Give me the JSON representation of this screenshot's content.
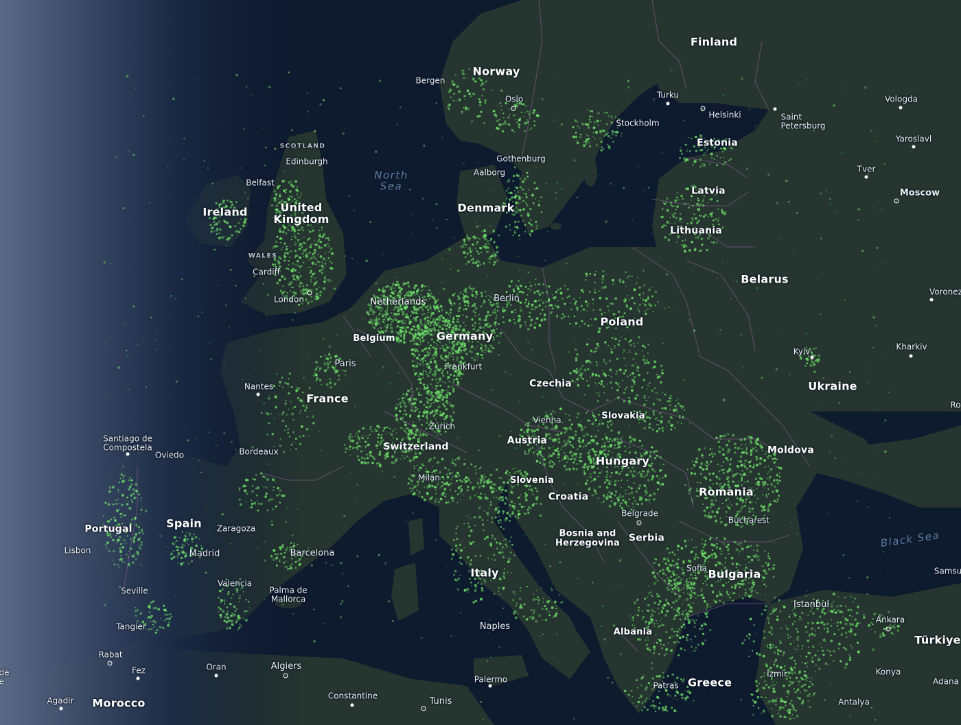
{
  "map": {
    "colors": {
      "water": "#0e1a2e",
      "land": "#26352f",
      "border": "#7a5a86",
      "activity": "#6fe06a"
    },
    "countries": [
      {
        "key": "norway",
        "name": "Norway"
      },
      {
        "key": "finland",
        "name": "Finland"
      },
      {
        "key": "estonia",
        "name": "Estonia"
      },
      {
        "key": "latvia",
        "name": "Latvia"
      },
      {
        "key": "lithuania",
        "name": "Lithuania"
      },
      {
        "key": "belarus",
        "name": "Belarus"
      },
      {
        "key": "denmark",
        "name": "Denmark"
      },
      {
        "key": "ireland",
        "name": "Ireland"
      },
      {
        "key": "uk",
        "name": "United\nKingdom"
      },
      {
        "key": "netherlands",
        "name": "Netherlands"
      },
      {
        "key": "belgium",
        "name": "Belgium"
      },
      {
        "key": "germany",
        "name": "Germany"
      },
      {
        "key": "poland",
        "name": "Poland"
      },
      {
        "key": "czechia",
        "name": "Czechia"
      },
      {
        "key": "slovakia",
        "name": "Slovakia"
      },
      {
        "key": "ukraine",
        "name": "Ukraine"
      },
      {
        "key": "france",
        "name": "France"
      },
      {
        "key": "austria",
        "name": "Austria"
      },
      {
        "key": "switzerland",
        "name": "Switzerland"
      },
      {
        "key": "hungary",
        "name": "Hungary"
      },
      {
        "key": "moldova",
        "name": "Moldova"
      },
      {
        "key": "romania",
        "name": "Romania"
      },
      {
        "key": "slovenia",
        "name": "Slovenia"
      },
      {
        "key": "croatia",
        "name": "Croatia"
      },
      {
        "key": "bosnia",
        "name": "Bosnia and\nHerzegovina"
      },
      {
        "key": "serbia",
        "name": "Serbia"
      },
      {
        "key": "bulgaria",
        "name": "Bulgaria"
      },
      {
        "key": "spain",
        "name": "Spain"
      },
      {
        "key": "portugal",
        "name": "Portugal"
      },
      {
        "key": "italy",
        "name": "Italy"
      },
      {
        "key": "albania",
        "name": "Albania"
      },
      {
        "key": "greece",
        "name": "Greece"
      },
      {
        "key": "turkiye",
        "name": "Türkiye"
      },
      {
        "key": "morocco",
        "name": "Morocco"
      }
    ],
    "cities": [
      {
        "key": "bergen",
        "name": "Bergen"
      },
      {
        "key": "oslo",
        "name": "Oslo"
      },
      {
        "key": "stockholm",
        "name": "Stockholm"
      },
      {
        "key": "turku",
        "name": "Turku"
      },
      {
        "key": "helsinki",
        "name": "Helsinki"
      },
      {
        "key": "saint_petersburg",
        "name": "Saint\nPetersburg"
      },
      {
        "key": "vologda",
        "name": "Vologda"
      },
      {
        "key": "yaroslavl",
        "name": "Yaroslavl"
      },
      {
        "key": "tver",
        "name": "Tver"
      },
      {
        "key": "moscow",
        "name": "Moscow"
      },
      {
        "key": "voronezh",
        "name": "Voronez"
      },
      {
        "key": "kharkiv",
        "name": "Kharkiv"
      },
      {
        "key": "kyiv",
        "name": "Kyiv"
      },
      {
        "key": "ro_cut",
        "name": "Ro"
      },
      {
        "key": "gothenburg",
        "name": "Gothenburg"
      },
      {
        "key": "aalborg",
        "name": "Aalborg"
      },
      {
        "key": "edinburgh",
        "name": "Edinburgh"
      },
      {
        "key": "belfast",
        "name": "Belfast"
      },
      {
        "key": "cardiff",
        "name": "Cardiff"
      },
      {
        "key": "london",
        "name": "London"
      },
      {
        "key": "berlin",
        "name": "Berlin"
      },
      {
        "key": "paris",
        "name": "Paris"
      },
      {
        "key": "frankfurt",
        "name": "Frankfurt"
      },
      {
        "key": "nantes",
        "name": "Nantes"
      },
      {
        "key": "vienna",
        "name": "Vienna"
      },
      {
        "key": "zurich",
        "name": "Zürich"
      },
      {
        "key": "bordeaux",
        "name": "Bordeaux"
      },
      {
        "key": "milan",
        "name": "Milan"
      },
      {
        "key": "santiago",
        "name": "Santiago de\nCompostela"
      },
      {
        "key": "oviedo",
        "name": "Oviedo"
      },
      {
        "key": "zaragoza",
        "name": "Zaragoza"
      },
      {
        "key": "madrid",
        "name": "Madrid"
      },
      {
        "key": "barcelona",
        "name": "Barcelona"
      },
      {
        "key": "lisbon",
        "name": "Lisbon"
      },
      {
        "key": "valencia",
        "name": "Valencia"
      },
      {
        "key": "palma",
        "name": "Palma de\nMallorca"
      },
      {
        "key": "seville",
        "name": "Seville"
      },
      {
        "key": "tangier",
        "name": "Tangier"
      },
      {
        "key": "rabat",
        "name": "Rabat"
      },
      {
        "key": "fez",
        "name": "Fez"
      },
      {
        "key": "oran",
        "name": "Oran"
      },
      {
        "key": "algiers",
        "name": "Algiers"
      },
      {
        "key": "agadir",
        "name": "Agadir"
      },
      {
        "key": "constantine",
        "name": "Constantine"
      },
      {
        "key": "tunis",
        "name": "Tunis"
      },
      {
        "key": "palermo",
        "name": "Palermo"
      },
      {
        "key": "naples",
        "name": "Naples"
      },
      {
        "key": "belgrade",
        "name": "Belgrade"
      },
      {
        "key": "bucharest",
        "name": "Bucharest"
      },
      {
        "key": "sofia",
        "name": "Sofia"
      },
      {
        "key": "istanbul",
        "name": "Istanbul"
      },
      {
        "key": "ankara",
        "name": "Ankara"
      },
      {
        "key": "samsun",
        "name": "Samsu"
      },
      {
        "key": "izmir",
        "name": "İzmir"
      },
      {
        "key": "konya",
        "name": "Konya"
      },
      {
        "key": "adana",
        "name": "Adana"
      },
      {
        "key": "antalya",
        "name": "Antalya"
      },
      {
        "key": "patras",
        "name": "Patras"
      },
      {
        "key": "de_cut",
        "name": "de\ne"
      }
    ],
    "regions": [
      {
        "key": "scotland",
        "name": "SCOTLAND"
      },
      {
        "key": "wales",
        "name": "WALES"
      }
    ],
    "seas": [
      {
        "key": "north_sea",
        "name": "North\nSea"
      },
      {
        "key": "black_sea",
        "name": "Black Sea"
      }
    ]
  }
}
